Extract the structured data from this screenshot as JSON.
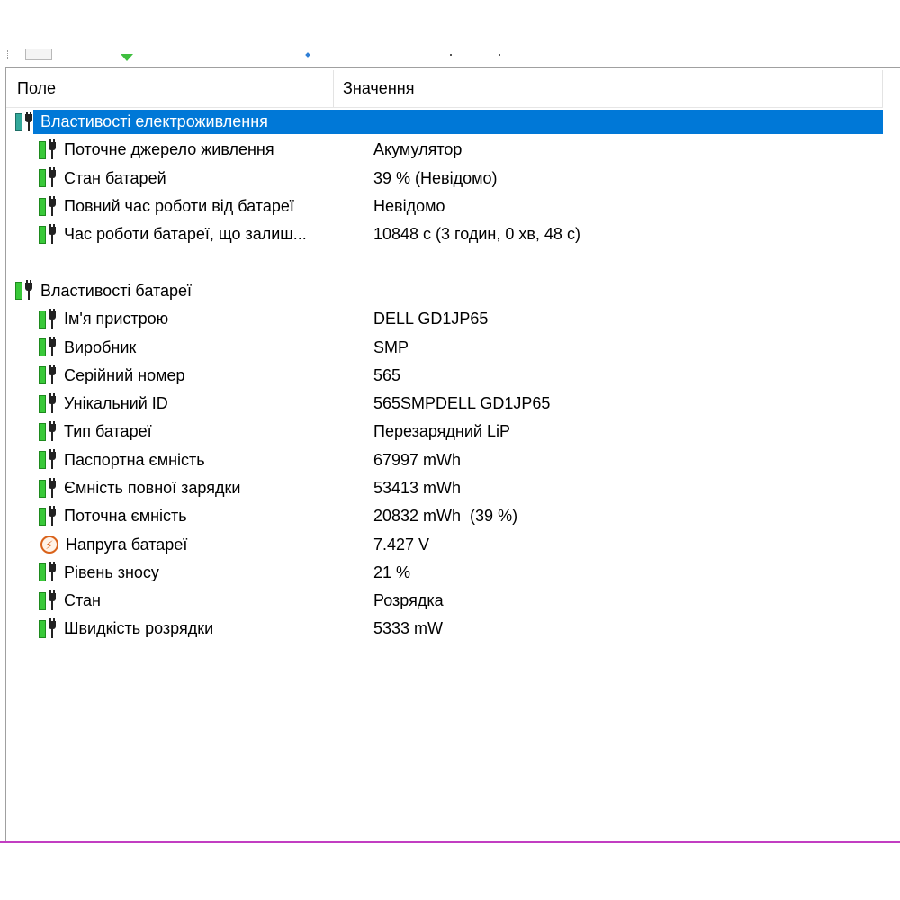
{
  "columns": {
    "field": "Поле",
    "value": "Значення"
  },
  "power_group": {
    "label": "Властивості електроживлення",
    "items": [
      {
        "field": "Поточне джерело живлення",
        "value": "Акумулятор"
      },
      {
        "field": "Стан батарей",
        "value": "39 % (Невідомо)"
      },
      {
        "field": "Повний час роботи від батареї",
        "value": "Невідомо"
      },
      {
        "field": "Час роботи батареї, що залиш...",
        "value": "10848 с (3 годин, 0 хв, 48 с)"
      }
    ]
  },
  "battery_group": {
    "label": "Властивості батареї",
    "items": [
      {
        "field": "Ім'я пристрою",
        "value": "DELL GD1JP65"
      },
      {
        "field": "Виробник",
        "value": "SMP"
      },
      {
        "field": "Серійний номер",
        "value": "565"
      },
      {
        "field": "Унікальний ID",
        "value": "565SMPDELL GD1JP65"
      },
      {
        "field": "Тип батареї",
        "value": "Перезарядний LiP"
      },
      {
        "field": "Паспортна ємність",
        "value": "67997 mWh"
      },
      {
        "field": "Ємність повної зарядки",
        "value": "53413 mWh"
      },
      {
        "field": "Поточна ємність",
        "value": "20832 mWh  (39 %)"
      },
      {
        "field": "Напруга батареї",
        "value": "7.427 V"
      },
      {
        "field": "Рівень зносу",
        "value": "21 %"
      },
      {
        "field": "Стан",
        "value": "Розрядка"
      },
      {
        "field": "Швидкість розрядки",
        "value": "5333 mW"
      }
    ]
  },
  "icons": {
    "group_power": "battery-plug-icon",
    "group_battery": "battery-plug-icon",
    "item": "battery-plug-icon",
    "voltage": "lightning-icon"
  },
  "colors": {
    "selection": "#0078d7",
    "battery_green": "#39c939",
    "battery_teal": "#33a89a",
    "voltage_orange": "#d9621a",
    "bottom_border": "#c23ec2"
  }
}
